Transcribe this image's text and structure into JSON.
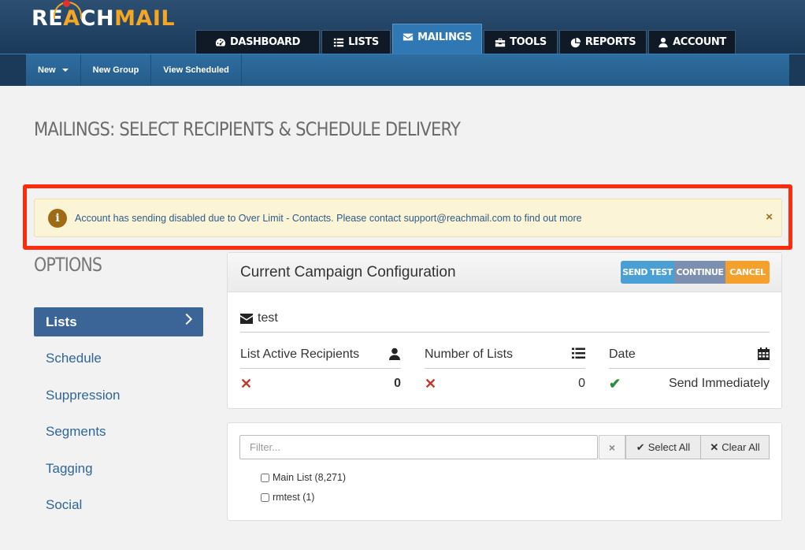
{
  "brand": {
    "logo_white": "RE",
    "logo_orange_a": "A",
    "logo_white2": "CH",
    "logo_orange": "MAIL"
  },
  "nav": {
    "tabs": [
      {
        "label": "DASHBOARD",
        "icon": "speedometer-icon"
      },
      {
        "label": "LISTS",
        "icon": "list-icon"
      },
      {
        "label": "MAILINGS",
        "icon": "envelope-icon",
        "active": true
      },
      {
        "label": "TOOLS",
        "icon": "toolbox-icon"
      },
      {
        "label": "REPORTS",
        "icon": "pie-chart-icon"
      },
      {
        "label": "ACCOUNT",
        "icon": "user-icon"
      }
    ]
  },
  "subnav": {
    "new": "New",
    "new_group": "New Group",
    "view_scheduled": "View Scheduled"
  },
  "page_title": "MAILINGS: SELECT RECIPIENTS & SCHEDULE DELIVERY",
  "alert": {
    "icon": "info-icon",
    "message": "Account has sending disabled due to Over Limit - Contacts. Please contact support@reachmail.com to find out more",
    "close": "×"
  },
  "options": {
    "title": "OPTIONS",
    "items": [
      "Lists",
      "Schedule",
      "Suppression",
      "Segments",
      "Tagging",
      "Social"
    ],
    "active": "Lists"
  },
  "campaign": {
    "title": "Current Campaign Configuration",
    "buttons": {
      "send_test": "SEND TEST",
      "continue": "CONTINUE",
      "cancel": "CANCEL"
    },
    "mailing_name": "test",
    "stats": [
      {
        "label": "List Active Recipients",
        "icon": "user-icon",
        "status": "✕",
        "value": "0"
      },
      {
        "label": "Number of Lists",
        "icon": "list-icon",
        "status": "✕",
        "value": "0"
      },
      {
        "label": "Date",
        "icon": "calendar-icon",
        "status": "✔",
        "value": "Send Immediately"
      }
    ]
  },
  "lists_panel": {
    "filter_placeholder": "Filter...",
    "clear_filter": "×",
    "select_all": "Select All",
    "clear_all": "Clear All",
    "lists": [
      "Main List (8,271)",
      "rmtest (1)"
    ]
  },
  "colors": {
    "accent": "#2f78b4",
    "alert_border": "#ff2a0c",
    "send_test": "#4a9fd4",
    "continue": "#7c8fb0",
    "cancel": "#f5a02a"
  }
}
